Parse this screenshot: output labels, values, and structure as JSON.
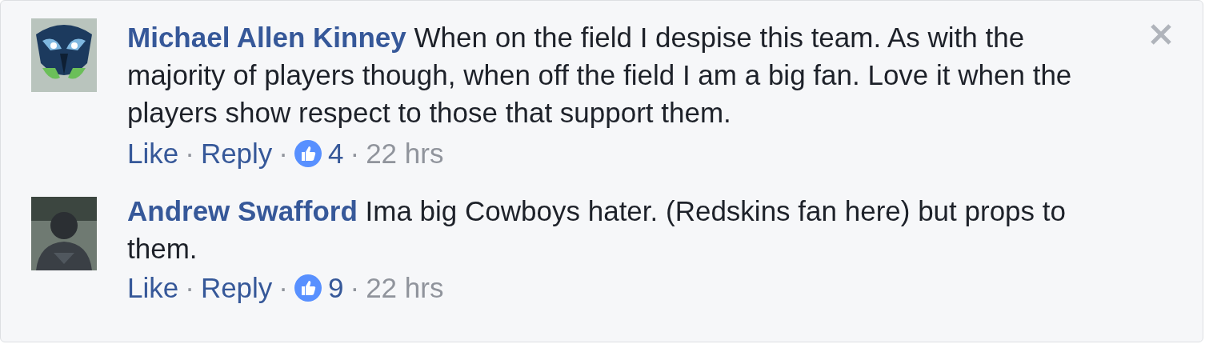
{
  "comments": [
    {
      "author": "Michael Allen Kinney",
      "text": "When on the field I despise this team. As with the majority of players though, when off the field I am a big fan. Love it when the players show respect to those that support them.",
      "actions": [
        "Like",
        "Reply"
      ],
      "separator": "·",
      "likes": "4",
      "time": "22 hrs"
    },
    {
      "author": "Andrew Swafford",
      "text": "Ima big Cowboys hater. (Redskins fan here) but props to them.",
      "actions": [
        "Like",
        "Reply"
      ],
      "separator": "·",
      "likes": "9",
      "time": "22 hrs",
      "avatar": {
        "kind": "silhouette"
      }
    }
  ]
}
